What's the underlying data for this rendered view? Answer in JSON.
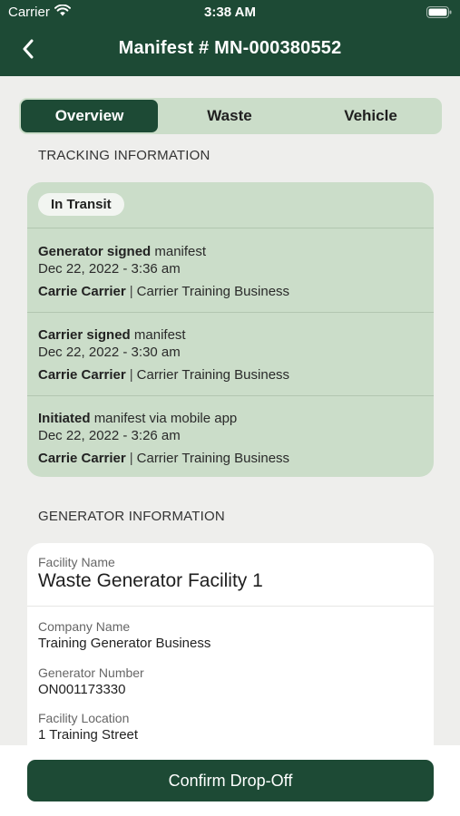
{
  "status_bar": {
    "carrier": "Carrier",
    "time": "3:38 AM",
    "wifi_icon": "wifi-icon",
    "battery_icon": "battery-icon"
  },
  "nav": {
    "title": "Manifest # MN-000380552",
    "back_icon": "chevron-left-icon"
  },
  "tabs": [
    {
      "label": "Overview",
      "active": true
    },
    {
      "label": "Waste",
      "active": false
    },
    {
      "label": "Vehicle",
      "active": false
    }
  ],
  "tracking": {
    "section_title": "TRACKING INFORMATION",
    "status": "In Transit",
    "events": [
      {
        "action": "Generator signed",
        "suffix": "manifest",
        "date": "Dec 22, 2022 - 3:36 am",
        "person": "Carrie Carrier",
        "separator": "|",
        "company": "Carrier Training Business"
      },
      {
        "action": "Carrier signed",
        "suffix": "manifest",
        "date": "Dec 22, 2022 - 3:30 am",
        "person": "Carrie Carrier",
        "separator": "|",
        "company": "Carrier Training Business"
      },
      {
        "action": "Initiated",
        "suffix": "manifest via mobile app",
        "date": "Dec 22, 2022 - 3:26 am",
        "person": "Carrie Carrier",
        "separator": "|",
        "company": "Carrier Training Business"
      }
    ]
  },
  "generator": {
    "section_title": "GENERATOR INFORMATION",
    "facility_name_label": "Facility Name",
    "facility_name": "Waste Generator Facility 1",
    "company_name_label": "Company Name",
    "company_name": "Training Generator Business",
    "generator_number_label": "Generator Number",
    "generator_number": "ON001173330",
    "facility_location_label": "Facility Location",
    "facility_location": "1 Training Street"
  },
  "actions": {
    "confirm_label": "Confirm Drop-Off"
  },
  "colors": {
    "primary": "#1d4a35",
    "card_green": "#cbddc9",
    "background": "#eeeeec"
  }
}
